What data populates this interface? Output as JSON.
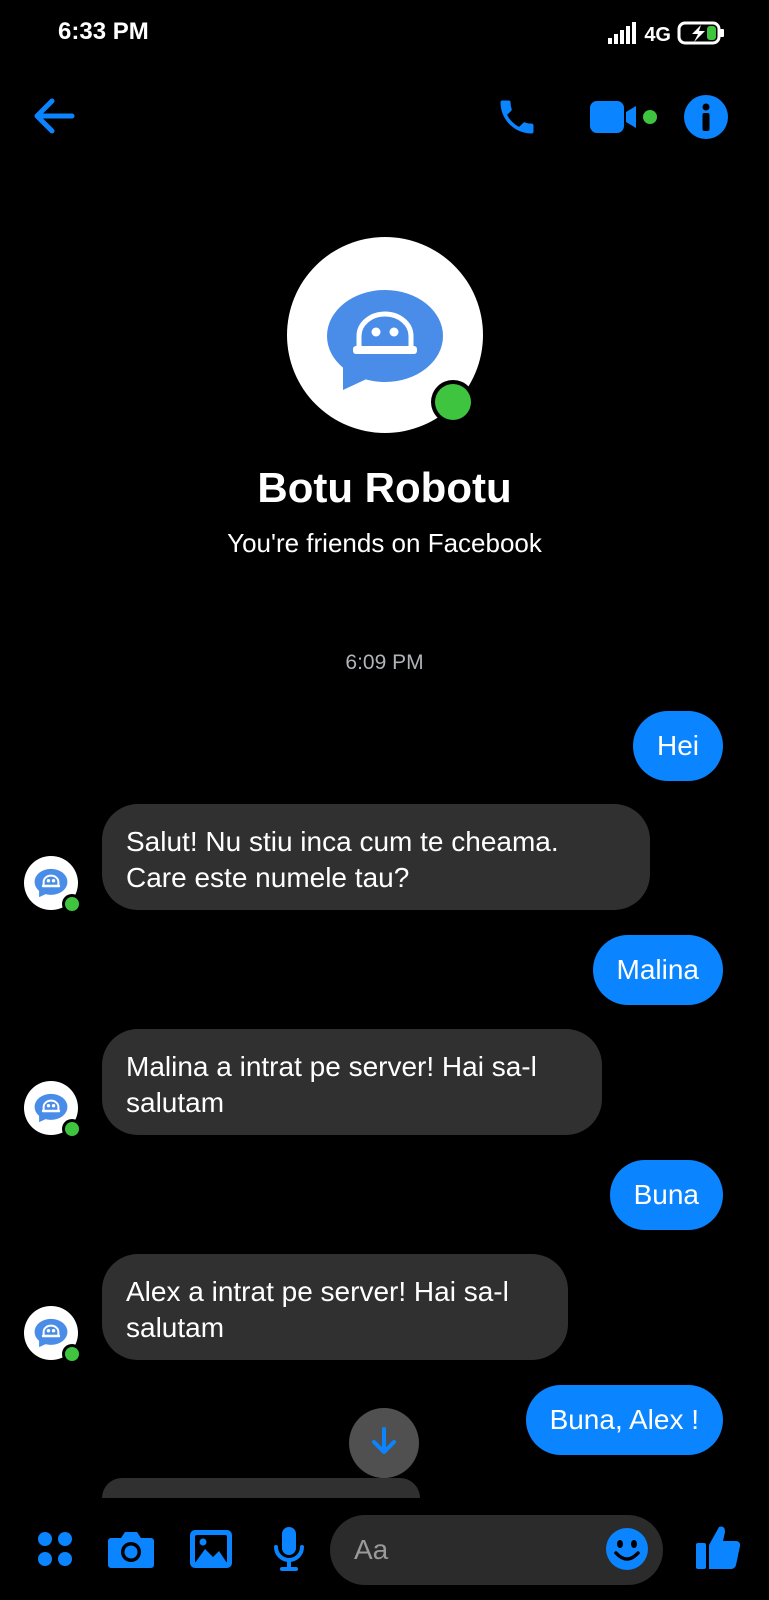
{
  "status_bar": {
    "time": "6:33 PM",
    "network": "4G"
  },
  "header": {
    "icons": [
      "back-arrow-icon",
      "phone-icon",
      "video-camera-icon",
      "info-icon"
    ],
    "accent_color": "#0a84ff",
    "online_color": "#3fc43f"
  },
  "profile": {
    "name": "Botu Robotu",
    "subtitle": "You're friends on Facebook"
  },
  "chat": {
    "timestamp": "6:09 PM",
    "messages": [
      {
        "direction": "outgoing",
        "text": "Hei"
      },
      {
        "direction": "incoming",
        "text": "Salut! Nu stiu inca cum te cheama. Care este numele tau?"
      },
      {
        "direction": "outgoing",
        "text": "Malina"
      },
      {
        "direction": "incoming",
        "text": "Malina a intrat pe server! Hai sa-l salutam"
      },
      {
        "direction": "outgoing",
        "text": "Buna"
      },
      {
        "direction": "incoming",
        "text": "Alex a intrat pe server! Hai sa-l salutam"
      },
      {
        "direction": "outgoing",
        "text": "Buna, Alex !"
      }
    ]
  },
  "composer": {
    "placeholder": "Aa",
    "icons": [
      "menu-dots-icon",
      "camera-icon",
      "gallery-icon",
      "microphone-icon",
      "emoji-icon",
      "thumbs-up-icon"
    ]
  }
}
